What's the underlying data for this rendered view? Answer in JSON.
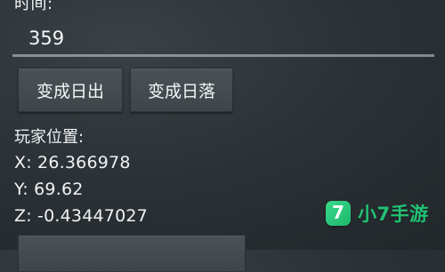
{
  "labels": {
    "time": "时间:",
    "player_position": "玩家位置:"
  },
  "time_input": {
    "value": "359"
  },
  "buttons": {
    "sunrise": "变成日出",
    "sunset": "变成日落"
  },
  "player_position": {
    "x": "X: 26.366978",
    "y": "Y: 69.62",
    "z": "Z: -0.43447027"
  },
  "watermark": {
    "icon_glyph": "7",
    "text": "小7手游",
    "accent_color": "#23c275"
  }
}
